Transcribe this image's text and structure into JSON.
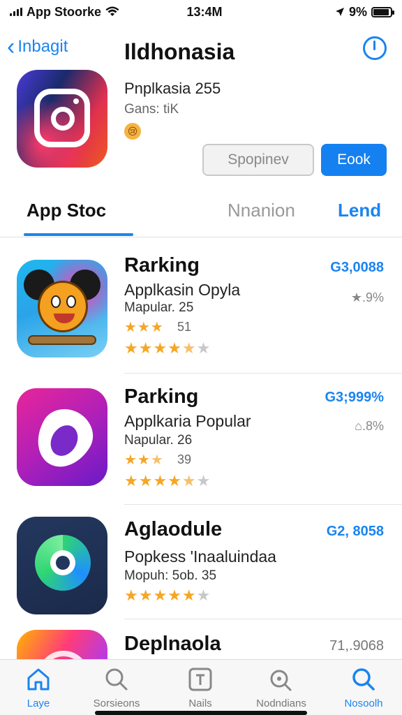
{
  "status_bar": {
    "carrier": "App Stoorke",
    "time": "13:4M",
    "battery": "9%",
    "battery_level": 0.9
  },
  "header": {
    "back_label": "Inbagit",
    "title": "Ildhonasia"
  },
  "hero": {
    "name": "Pnplkasia 255",
    "subtitle": "Gans: tiK",
    "emoji": "😢",
    "secondary_button": "Spopinev",
    "primary_button": "Eook"
  },
  "tabs": [
    {
      "label": "App Stoc"
    },
    {
      "label": "Nnanion"
    },
    {
      "label": "Lend"
    }
  ],
  "list": [
    {
      "title": "Rarking",
      "subtitle": "Applkasin Opyla",
      "meta": "Mapular. 25",
      "price": "G3,0088",
      "pct": "★.9%",
      "small_rating": "51",
      "stars_small": 3,
      "rating": 4.5
    },
    {
      "title": "Parking",
      "subtitle": "Applkaria Popular",
      "meta": "Napular. 26",
      "price": "G3;999%",
      "pct": "⌂.8%",
      "small_rating": "39",
      "stars_small": 2.5,
      "rating": 4.5
    },
    {
      "title": "Aglaodule",
      "subtitle": "Popkess 'Inaaluindaa",
      "meta": "Mopuh: 5ob. 35",
      "price": "G2, 8058",
      "pct": "",
      "rating": 5
    },
    {
      "title": "Deplnaola",
      "price": "71,.9068"
    }
  ],
  "tabbar": [
    {
      "label": "Laye",
      "icon": "home-icon",
      "active": true
    },
    {
      "label": "Sorsieons",
      "icon": "search-icon",
      "active": false
    },
    {
      "label": "Nails",
      "icon": "apps-icon",
      "active": false
    },
    {
      "label": "Nodndians",
      "icon": "magnifier-icon",
      "active": false
    },
    {
      "label": "Nosoolh",
      "icon": "search-icon",
      "active": true
    }
  ]
}
